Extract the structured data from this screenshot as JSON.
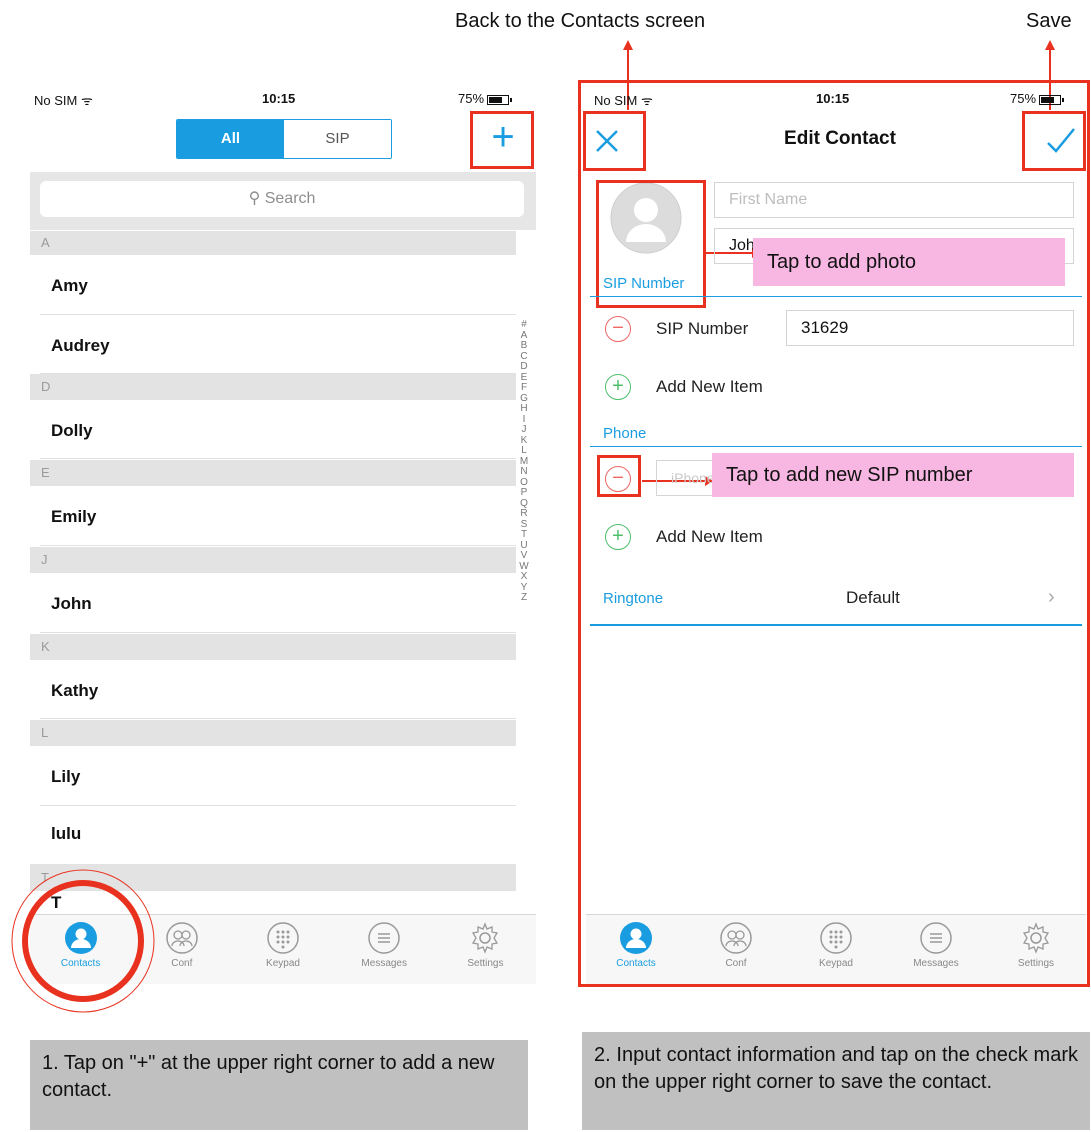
{
  "annotations": {
    "back_label": "Back to the Contacts screen",
    "save_label": "Save",
    "photo_hint": "Tap to add photo",
    "sip_hint": "Tap to add new SIP number",
    "caption_left": "1. Tap on \"+\" at the upper right corner to add a new contact.",
    "caption_right": "2. Input contact information and tap on the check mark on the upper right corner to save the contact."
  },
  "status": {
    "carrier": "No SIM",
    "time": "10:15",
    "battery": "75%"
  },
  "contacts_screen": {
    "segment_all": "All",
    "segment_sip": "SIP",
    "add_glyph": "+",
    "search_placeholder": "Search",
    "sections": [
      {
        "header": "A",
        "items": [
          "Amy",
          "Audrey"
        ]
      },
      {
        "header": "D",
        "items": [
          "Dolly"
        ]
      },
      {
        "header": "E",
        "items": [
          "Emily"
        ]
      },
      {
        "header": "J",
        "items": [
          "John"
        ]
      },
      {
        "header": "K",
        "items": [
          "Kathy"
        ]
      },
      {
        "header": "L",
        "items": [
          "Lily",
          "lulu"
        ]
      },
      {
        "header": "T",
        "items": [
          "T"
        ]
      }
    ],
    "index_letters": [
      "#",
      "A",
      "B",
      "C",
      "D",
      "E",
      "F",
      "G",
      "H",
      "I",
      "J",
      "K",
      "L",
      "M",
      "N",
      "O",
      "P",
      "Q",
      "R",
      "S",
      "T",
      "U",
      "V",
      "W",
      "X",
      "Y",
      "Z"
    ]
  },
  "edit_screen": {
    "title": "Edit Contact",
    "first_name_placeholder": "First Name",
    "last_name_value": "John",
    "sip_section": "SIP Number",
    "sip_label": "SIP Number",
    "sip_value": "31629",
    "add_item": "Add New Item",
    "phone_section": "Phone",
    "phone_placeholder": "iPhone",
    "ringtone_label": "Ringtone",
    "ringtone_value": "Default"
  },
  "tabs": [
    "Contacts",
    "Conf",
    "Keypad",
    "Messages",
    "Settings"
  ],
  "colors": {
    "accent": "#1a9de0",
    "annotation_red": "#e8321f",
    "annotation_pink": "#f8b6e2",
    "caption_gray": "#c0c0c0"
  }
}
